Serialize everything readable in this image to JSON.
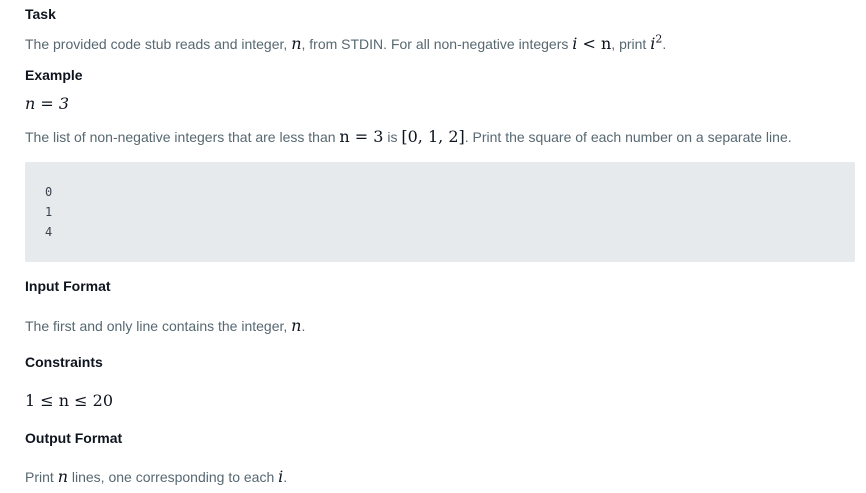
{
  "task": {
    "heading": "Task",
    "text_prefix": "The provided code stub reads and integer,",
    "text_var_n": "n",
    "text_middle": ", from STDIN. For all non-negative integers",
    "text_ineq": "< n",
    "text_var_i": "i",
    "text_suffix": ", print",
    "text_power_base": "i",
    "text_power_exp": "2",
    "text_end": "."
  },
  "example": {
    "heading": "Example",
    "assignment": "n = 3",
    "text_prefix": "The list of non-negative integers that are less than",
    "text_expr": "n = 3",
    "text_is": "is",
    "text_list": "[0, 1, 2]",
    "text_suffix": ". Print the square of each number on a separate line.",
    "output_lines": [
      "0",
      "1",
      "4"
    ]
  },
  "input_format": {
    "heading": "Input Format",
    "text_prefix": "The first and only line contains the integer,",
    "text_var": "n",
    "text_end": "."
  },
  "constraints": {
    "heading": "Constraints",
    "expression": "1 ≤ n ≤ 20"
  },
  "output_format": {
    "heading": "Output Format",
    "text_prefix": "Print",
    "text_var_n": "n",
    "text_middle": "lines, one corresponding to each",
    "text_var_i": "i",
    "text_end": "."
  }
}
